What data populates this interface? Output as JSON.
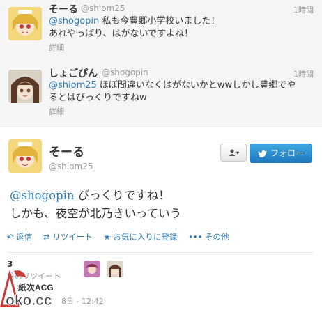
{
  "tweets": [
    {
      "name": "そーる",
      "handle": "@shiom25",
      "time": "1時間",
      "mention": "@shogopin",
      "line1_rest": " 私も今豊郷小学校いました！",
      "line2": "あれやっぱり、はがないですよね！",
      "detail": "詳細"
    },
    {
      "name": "しょごぴん",
      "handle": "@shogopin",
      "time": "1時間",
      "mention": "@shiom25",
      "line1_rest": " ほぼ間違いなくはがないかとwwしかし豊郷でや",
      "line2": "るとはびっくりですねw",
      "detail": "詳細"
    }
  ],
  "main": {
    "name": "そーる",
    "handle": "@shiom25",
    "user_button": "▲▼",
    "follow_label": "フォロー",
    "mention": "@shogopin",
    "line1_rest": " びっくりですね！",
    "line2": "しかも、夜空が北乃きいっていう",
    "actions": {
      "reply": "返信",
      "retweet": "リツイート",
      "favorite": "お気に入りに登録",
      "more": "その他"
    },
    "retweet_count": "3",
    "retweet_label": "件のリツイート",
    "date": "8日 - 12:42"
  },
  "watermark": {
    "text1": "紙次ACG",
    "text2": "oko.cc"
  },
  "colors": {
    "link": "#2a7bb6",
    "follow_btn": "#2d8fd5"
  }
}
